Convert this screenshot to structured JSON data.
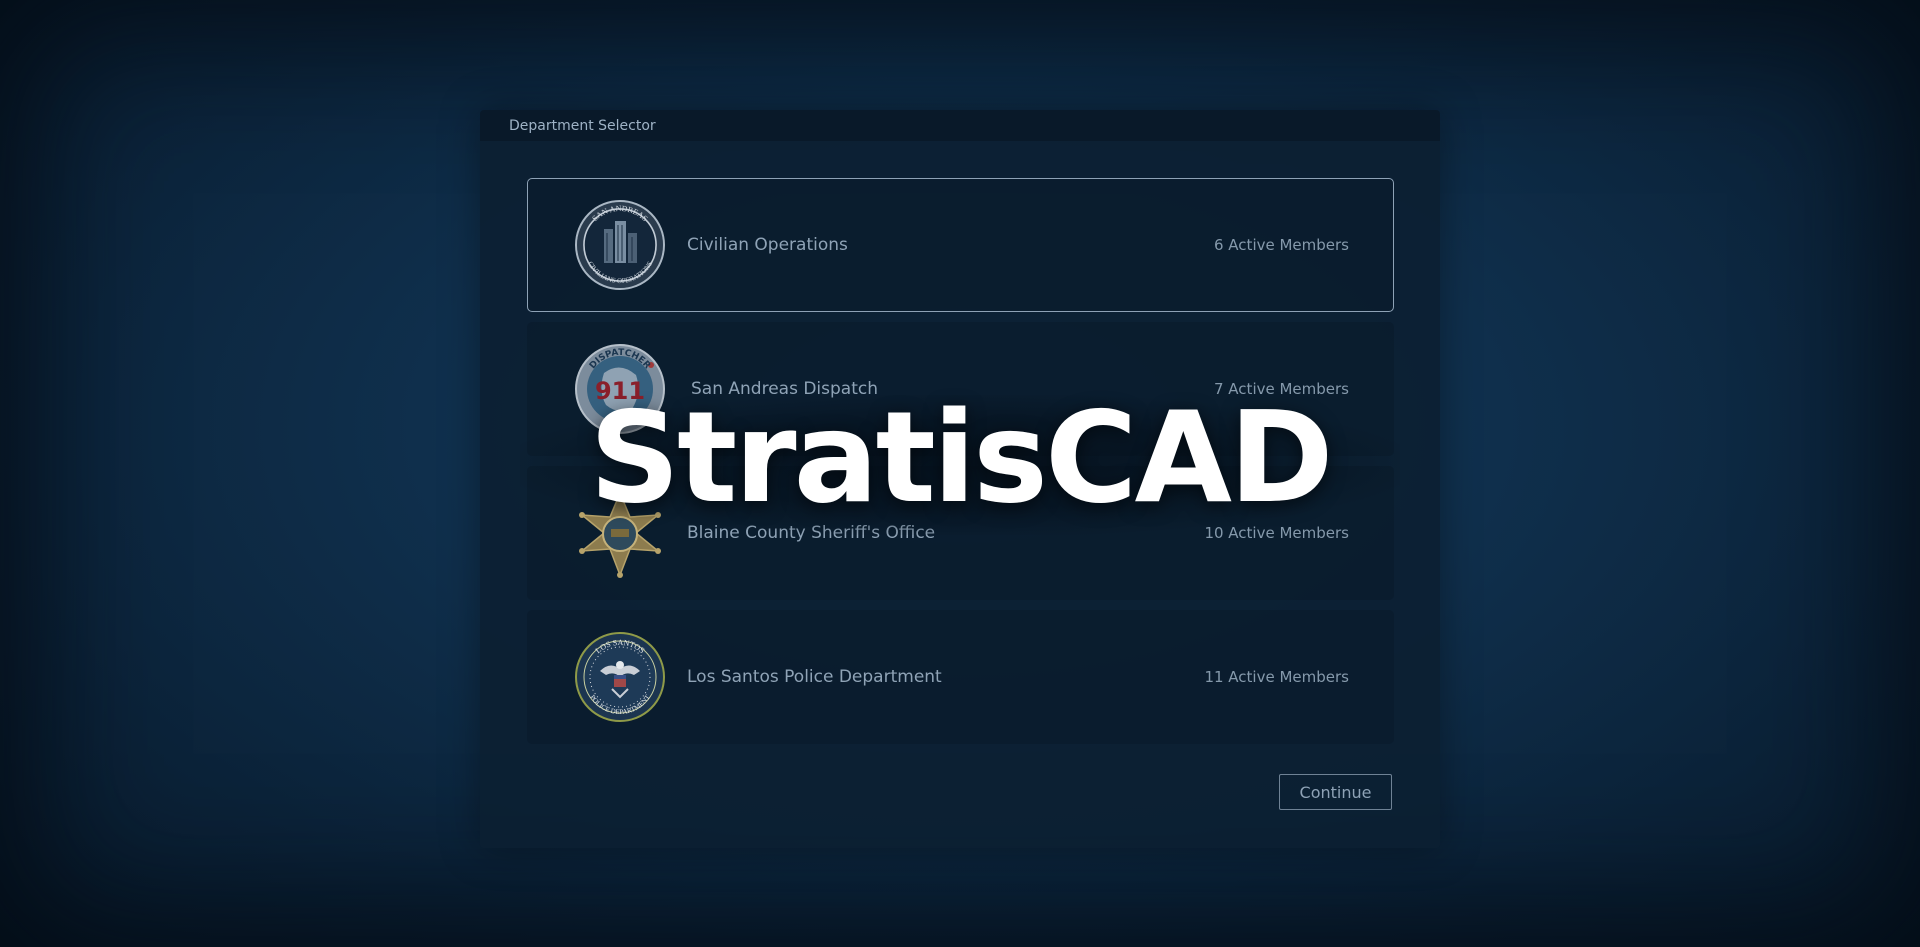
{
  "panel": {
    "title": "Department Selector"
  },
  "departments": [
    {
      "name": "Civilian Operations",
      "members": "6 Active Members",
      "logo_icon": "civilian-operations-seal-icon",
      "logo_text_top": "SAN ANDREAS",
      "logo_text_bottom": "CIVILIANS OPERATIONS",
      "selected": true
    },
    {
      "name": "San Andreas Dispatch",
      "members": "7 Active Members",
      "logo_icon": "dispatch-911-seal-icon",
      "logo_text_top": "DISPATCHER",
      "logo_text_center": "911",
      "selected": false
    },
    {
      "name": "Blaine County Sheriff's Office",
      "members": "10 Active Members",
      "logo_icon": "sheriff-star-badge-icon",
      "selected": false
    },
    {
      "name": "Los Santos Police Department",
      "members": "11 Active Members",
      "logo_icon": "police-department-seal-icon",
      "logo_text_top": "LOS SANTOS",
      "logo_text_bottom": "POLICE DEPARTMENT",
      "selected": false
    }
  ],
  "actions": {
    "continue_label": "Continue"
  },
  "brand": {
    "name": "StratisCAD"
  },
  "colors": {
    "background": "#0f2f4c",
    "panel": "#0c1f32",
    "selected_border": "#8ea2b6",
    "text": "#8fa3b6",
    "brand": "#ffffff"
  }
}
